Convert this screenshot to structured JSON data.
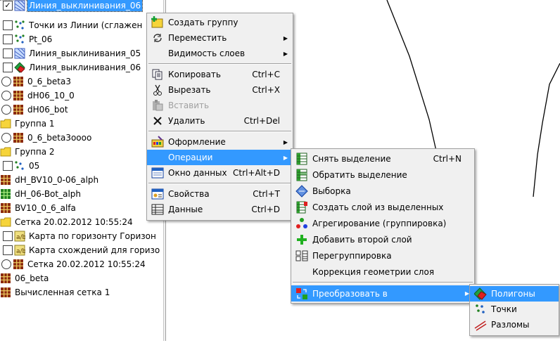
{
  "tree": {
    "items": [
      {
        "label": "Линия_выклинивания_06",
        "checked": true,
        "selected": true
      },
      {
        "label": "Точки из Линии (сглажен",
        "checked": false
      },
      {
        "label": "Pt_06",
        "checked": false
      },
      {
        "label": "Линия_выклинивания_05",
        "checked": false
      },
      {
        "label": "Линия_выклинивания_06",
        "checked": false
      },
      {
        "label": "0_6_beta3"
      },
      {
        "label": "dH06_10_0"
      },
      {
        "label": "dH06_bot"
      },
      {
        "label": "Группа 1"
      },
      {
        "label": "0_6_beta3oooo"
      },
      {
        "label": "Группа 2"
      },
      {
        "label": "05",
        "checked": false
      },
      {
        "label": "dH_BV10_0-06_alph"
      },
      {
        "label": "dH_06-Bot_alph"
      },
      {
        "label": "BV10_0_6_alfa"
      },
      {
        "label": "Сетка 20.02.2012 10:55:24"
      },
      {
        "label": "Карта по горизонту Горизон",
        "checked": false
      },
      {
        "label": "Карта схождений для горизо",
        "checked": false
      },
      {
        "label": "Сетка 20.02.2012 10:55:24"
      },
      {
        "label": "06_beta"
      },
      {
        "label": "Вычисленная сетка 1"
      }
    ]
  },
  "context_menu": {
    "items": [
      {
        "label": "Создать группу",
        "icon": "folder-plus-icon"
      },
      {
        "label": "Переместить",
        "icon": "move-icon",
        "submenu": true
      },
      {
        "label": "Видимость слоев",
        "submenu": true
      },
      {
        "label": "Копировать",
        "shortcut": "Ctrl+C",
        "icon": "copy-icon"
      },
      {
        "label": "Вырезать",
        "shortcut": "Ctrl+X",
        "icon": "scissors-icon"
      },
      {
        "label": "Вставить",
        "disabled": true,
        "icon": "paste-icon"
      },
      {
        "label": "Удалить",
        "shortcut": "Ctrl+Del",
        "icon": "delete-icon"
      },
      {
        "label": "Оформление",
        "submenu": true,
        "icon": "palette-icon"
      },
      {
        "label": "Операции",
        "submenu": true,
        "highlighted": true
      },
      {
        "label": "Окно данных",
        "shortcut": "Ctrl+Alt+D",
        "icon": "window-icon"
      },
      {
        "label": "Свойства",
        "shortcut": "Ctrl+T",
        "icon": "properties-icon"
      },
      {
        "label": "Данные",
        "shortcut": "Ctrl+D",
        "icon": "table-icon"
      }
    ]
  },
  "operations_menu": {
    "items": [
      {
        "label": "Снять выделение",
        "shortcut": "Ctrl+N"
      },
      {
        "label": "Обратить выделение"
      },
      {
        "label": "Выборка"
      },
      {
        "label": "Создать слой из выделенных"
      },
      {
        "label": "Агрегирование (группировка)"
      },
      {
        "label": "Добавить второй слой"
      },
      {
        "label": "Перегруппировка"
      },
      {
        "label": "Коррекция геометрии слоя"
      },
      {
        "label": "Преобразовать в",
        "submenu": true,
        "highlighted": true
      }
    ]
  },
  "convert_menu": {
    "items": [
      {
        "label": "Полигоны",
        "highlighted": true
      },
      {
        "label": "Точки"
      },
      {
        "label": "Разломы"
      }
    ]
  },
  "colors": {
    "highlight": "#3399ff",
    "menu_bg": "#f0f0f0"
  }
}
